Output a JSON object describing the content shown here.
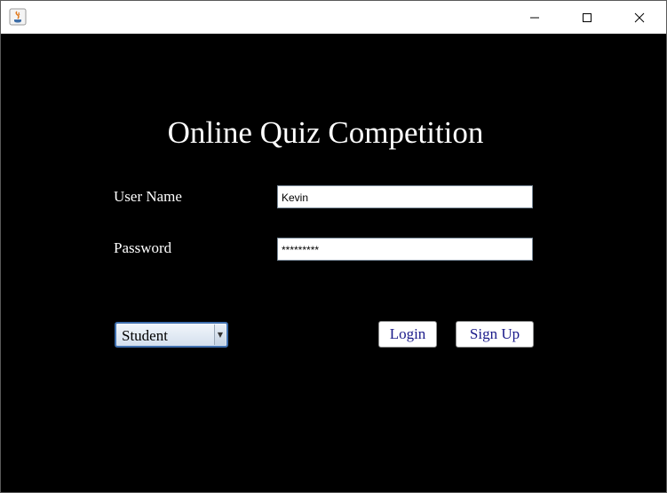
{
  "window": {
    "title": "",
    "controls": {
      "minimize": "minimize",
      "maximize": "maximize",
      "close": "close"
    }
  },
  "form": {
    "heading": "Online Quiz Competition",
    "username_label": "User Name",
    "username_value": "Kevin",
    "password_label": "Password",
    "password_value": "*********",
    "role_selected": "Student",
    "login_label": "Login",
    "signup_label": "Sign Up"
  },
  "colors": {
    "background": "#000000",
    "text": "#ffffff",
    "button_text": "#1a1a8a",
    "select_border": "#3f6fae"
  }
}
